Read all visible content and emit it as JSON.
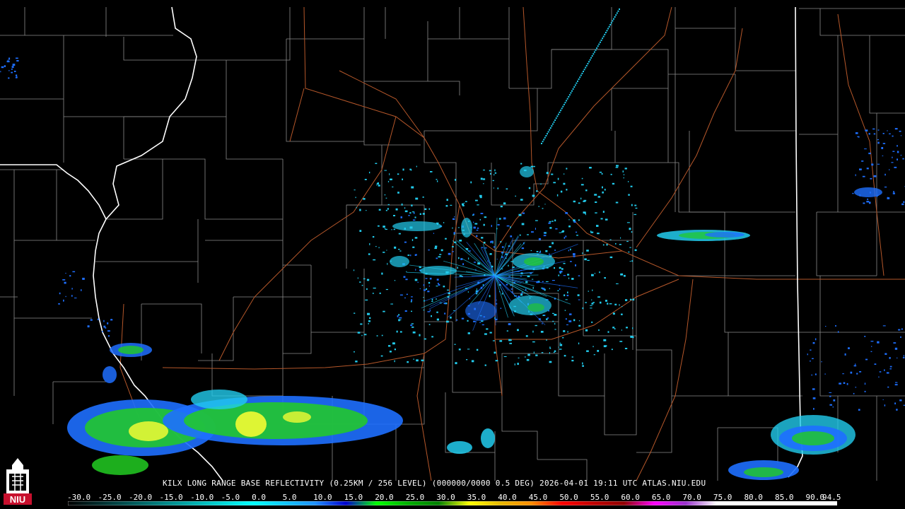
{
  "product": {
    "caption": "KILX LONG RANGE BASE REFLECTIVITY (0.25KM / 256 LEVEL) (000000/0000 0.5 DEG) 2026-04-01 19:11 UTC  ATLAS.NIU.EDU"
  },
  "logo": {
    "text": "NIU",
    "color": "#c8102e"
  },
  "scale": {
    "labels": [
      "-30.0",
      "-25.0",
      "-20.0",
      "-15.0",
      "-10.0",
      "-5.0",
      "0.0",
      "5.0",
      "10.0",
      "15.0",
      "20.0",
      "25.0",
      "30.0",
      "35.0",
      "40.0",
      "45.0",
      "50.0",
      "55.0",
      "60.0",
      "65.0",
      "70.0",
      "75.0",
      "80.0",
      "85.0",
      "90.0",
      "94.5"
    ],
    "stops": [
      {
        "dbz": -30,
        "color": "#000000"
      },
      {
        "dbz": 0,
        "color": "#00ffff"
      },
      {
        "dbz": 10,
        "color": "#1e90ff"
      },
      {
        "dbz": 15,
        "color": "#0000cd"
      },
      {
        "dbz": 20,
        "color": "#00ff00"
      },
      {
        "dbz": 25,
        "color": "#00b000"
      },
      {
        "dbz": 30,
        "color": "#008000"
      },
      {
        "dbz": 35,
        "color": "#ffff00"
      },
      {
        "dbz": 40,
        "color": "#e6b800"
      },
      {
        "dbz": 45,
        "color": "#ff8c00"
      },
      {
        "dbz": 50,
        "color": "#ff0000"
      },
      {
        "dbz": 55,
        "color": "#c00000"
      },
      {
        "dbz": 60,
        "color": "#900000"
      },
      {
        "dbz": 65,
        "color": "#ff00ff"
      },
      {
        "dbz": 70,
        "color": "#9932cc"
      },
      {
        "dbz": 75,
        "color": "#ffffff"
      },
      {
        "dbz": 94.5,
        "color": "#ffffff"
      }
    ]
  },
  "colors": {
    "county_lines": "#8a8a8a",
    "state_lines": "#ffffff",
    "highways": "#b5572a",
    "echo_cyan": "#22ccee",
    "echo_blue": "#1e6fff",
    "echo_green": "#22cc22",
    "echo_yellow": "#ffff33"
  }
}
